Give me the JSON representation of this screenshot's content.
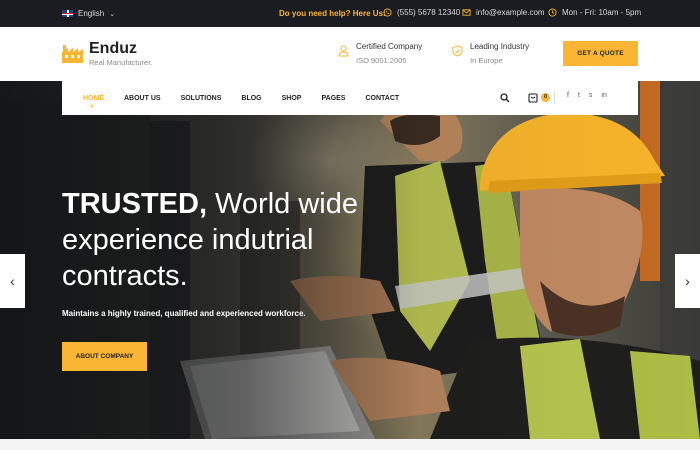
{
  "topbar": {
    "language": "English",
    "help_text": "Do you need help? Here Us:",
    "phone": "(555) 5678 12340",
    "email": "info@example.com",
    "hours": "Mon - Fri: 10am - 5pm"
  },
  "header": {
    "brand": "Enduz",
    "tagline": "Real Manufacturer.",
    "features": [
      {
        "title": "Certified Company",
        "subtitle": "ISO 9001:2005",
        "icon": "user-badge-icon"
      },
      {
        "title": "Leading Industry",
        "subtitle": "In Europe",
        "icon": "shield-check-icon"
      }
    ],
    "quote_button": "GET A QUOTE"
  },
  "nav": {
    "items": [
      "HOME",
      "ABOUT US",
      "SOLUTIONS",
      "BLOG",
      "SHOP",
      "PAGES",
      "CONTACT"
    ],
    "active": "HOME",
    "cart_count": "0",
    "socials": [
      "f",
      "t",
      "s",
      "in"
    ]
  },
  "hero": {
    "headline_bold": "TRUSTED,",
    "headline_rest": " World wide",
    "headline_line2": "experience indutrial",
    "headline_line3": "contracts.",
    "subline": "Maintains a highly trained, qualified and experienced workforce.",
    "button": "ABOUT COMPANY"
  },
  "colors": {
    "accent": "#fbb534",
    "topbar_bg": "#1b1c21"
  }
}
